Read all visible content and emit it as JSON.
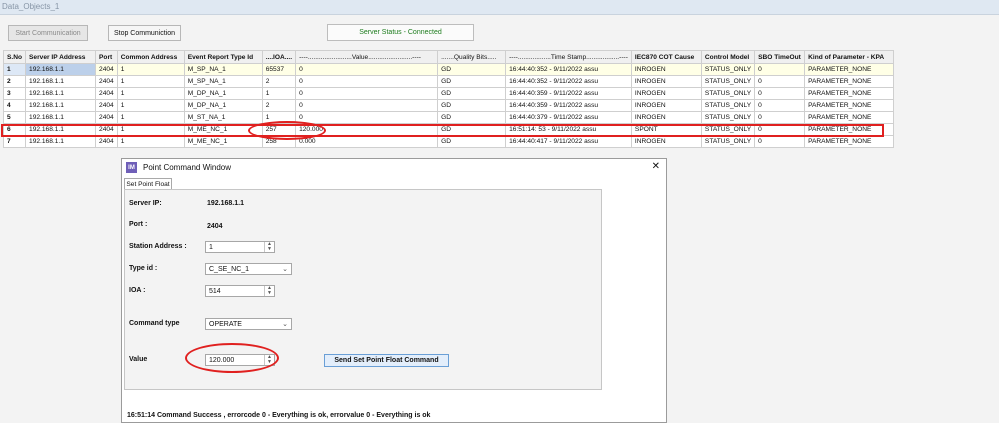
{
  "window": {
    "title": "Data_Objects_1"
  },
  "toolbar": {
    "start_label": "Start Communication",
    "stop_label": "Stop Communiction",
    "status_text": "Server Status - Connected"
  },
  "grid": {
    "columns": [
      "S.No",
      "Server IP Address",
      "Port",
      "Common Address",
      "Event Report Type Id",
      "....IOA....",
      "----........................Value........................----",
      ".......Quality Bits.....",
      "----..................Time Stamp..................----",
      "IEC870 COT Cause",
      "Control Model",
      "SBO TimeOut",
      "Kind of Parameter - KPA"
    ],
    "rows": [
      [
        "1",
        "192.168.1.1",
        "2404",
        "1",
        "M_SP_NA_1",
        "65537",
        "0",
        "GD",
        "16:44:40:352 - 9/11/2022 assu",
        "INROGEN",
        "STATUS_ONLY",
        "0",
        "PARAMETER_NONE"
      ],
      [
        "2",
        "192.168.1.1",
        "2404",
        "1",
        "M_SP_NA_1",
        "2",
        "0",
        "GD",
        "16:44:40:352 - 9/11/2022 assu",
        "INROGEN",
        "STATUS_ONLY",
        "0",
        "PARAMETER_NONE"
      ],
      [
        "3",
        "192.168.1.1",
        "2404",
        "1",
        "M_DP_NA_1",
        "1",
        "0",
        "GD",
        "16:44:40:359 - 9/11/2022 assu",
        "INROGEN",
        "STATUS_ONLY",
        "0",
        "PARAMETER_NONE"
      ],
      [
        "4",
        "192.168.1.1",
        "2404",
        "1",
        "M_DP_NA_1",
        "2",
        "0",
        "GD",
        "16:44:40:359 - 9/11/2022 assu",
        "INROGEN",
        "STATUS_ONLY",
        "0",
        "PARAMETER_NONE"
      ],
      [
        "5",
        "192.168.1.1",
        "2404",
        "1",
        "M_ST_NA_1",
        "1",
        "0",
        "GD",
        "16:44:40:379 - 9/11/2022 assu",
        "INROGEN",
        "STATUS_ONLY",
        "0",
        "PARAMETER_NONE"
      ],
      [
        "6",
        "192.168.1.1",
        "2404",
        "1",
        "M_ME_NC_1",
        "257",
        "120.000",
        "GD",
        "16:51:14: 53 - 9/11/2022 assu",
        "SPONT",
        "STATUS_ONLY",
        "0",
        "PARAMETER_NONE"
      ],
      [
        "7",
        "192.168.1.1",
        "2404",
        "1",
        "M_ME_NC_1",
        "258",
        "0.000",
        "GD",
        "16:44:40:417 - 9/11/2022 assu",
        "INROGEN",
        "STATUS_ONLY",
        "0",
        "PARAMETER_NONE"
      ]
    ]
  },
  "dialog": {
    "title": "Point Command Window",
    "icon_text": "IM",
    "close_glyph": "✕",
    "tab": "Set Point Float",
    "server_ip_label": "Server IP:",
    "server_ip_value": "192.168.1.1",
    "port_label": "Port :",
    "port_value": "2404",
    "station_label": "Station Address :",
    "station_value": "1",
    "type_label": "Type id :",
    "type_value": "C_SE_NC_1",
    "ioa_label": "IOA :",
    "ioa_value": "514",
    "command_type_label": "Command type",
    "command_type_value": "OPERATE",
    "value_label": "Value",
    "value_value": "120.000",
    "send_label": "Send Set Point Float Command",
    "message": "16:51:14 Command Success , errorcode 0 - Everything is ok, errorvalue 0 - Everything is ok"
  },
  "colors": {
    "highlight": "#e0201f",
    "status_green": "#1e7d1e",
    "selected_cell": "#bcd0ea"
  }
}
